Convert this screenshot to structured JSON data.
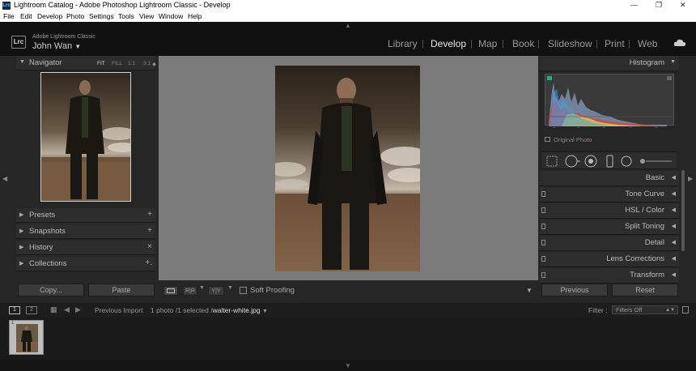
{
  "window": {
    "title": "Lightroom Catalog - Adobe Photoshop Lightroom Classic - Develop",
    "app_icon": "Lrc"
  },
  "menu": [
    "File",
    "Edit",
    "Develop",
    "Photo",
    "Settings",
    "Tools",
    "View",
    "Window",
    "Help"
  ],
  "identity": {
    "product": "Adobe Lightroom Classic",
    "user": "John Wan",
    "badge": "Lrc"
  },
  "modules": [
    "Library",
    "Develop",
    "Map",
    "Book",
    "Slideshow",
    "Print",
    "Web"
  ],
  "active_module": "Develop",
  "left": {
    "navigator": {
      "title": "Navigator",
      "zoom_options": [
        "FIT",
        "FILL",
        "1:1",
        "3:1"
      ],
      "selected_zoom": "FIT"
    },
    "panels": [
      {
        "label": "Presets",
        "action": "+"
      },
      {
        "label": "Snapshots",
        "action": "+"
      },
      {
        "label": "History",
        "action": "×"
      },
      {
        "label": "Collections",
        "action": "+."
      }
    ],
    "copy_label": "Copy...",
    "paste_label": "Paste"
  },
  "toolbar": {
    "soft_proofing_label": "Soft Proofing",
    "soft_proofing_checked": false
  },
  "right": {
    "histogram_title": "Histogram",
    "original_photo_label": "Original Photo",
    "panels": [
      "Basic",
      "Tone Curve",
      "HSL / Color",
      "Split Toning",
      "Detail",
      "Lens Corrections",
      "Transform"
    ],
    "previous_label": "Previous",
    "reset_label": "Reset"
  },
  "filmbar": {
    "view1": "1",
    "view2": "2",
    "source": "Previous Import",
    "selection_info": "1 photo /1 selected /",
    "filename": "walter-white.jpg",
    "filter_label": "Filter :",
    "filter_value": "Filters Off"
  },
  "colors": {
    "accent": "#e8e8e8",
    "panel_bg": "#262626",
    "canvas_bg": "#7b7b7b",
    "top_bar": "#111111"
  }
}
